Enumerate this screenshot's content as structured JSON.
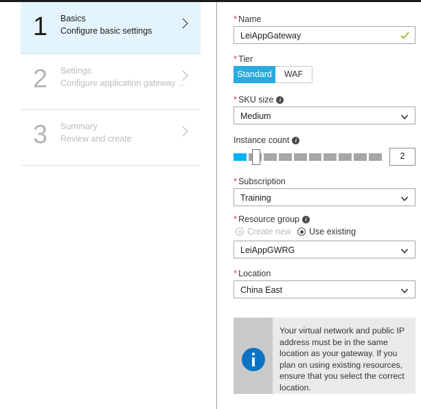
{
  "wizard": {
    "steps": [
      {
        "number": "1",
        "title": "Basics",
        "subtitle": "Configure basic settings",
        "chevron": "chevron-right-icon",
        "active": true
      },
      {
        "number": "2",
        "title": "Settings",
        "subtitle": "Configure application gateway ...",
        "chevron": "chevron-right-icon",
        "active": false
      },
      {
        "number": "3",
        "title": "Summary",
        "subtitle": "Review and create",
        "chevron": "chevron-right-icon",
        "active": false
      }
    ]
  },
  "form": {
    "name": {
      "label": "Name",
      "required": "*",
      "value": "LeiAppGateway",
      "validation_icon": "check-valid-icon"
    },
    "tier": {
      "label": "Tier",
      "required": "*",
      "options": [
        "Standard",
        "WAF"
      ],
      "selected": "Standard"
    },
    "sku_size": {
      "label": "SKU size",
      "required": "*",
      "info_icon": "info-icon",
      "value": "Medium",
      "chevron": "chevron-down-icon"
    },
    "instance_count": {
      "label": "Instance count",
      "info_icon": "info-icon",
      "value": "2",
      "segments": 10,
      "filled_segments": 1
    },
    "subscription": {
      "label": "Subscription",
      "required": "*",
      "value": "Training",
      "chevron": "chevron-down-icon"
    },
    "resource_group": {
      "label": "Resource group",
      "required": "*",
      "info_icon": "info-icon",
      "option_create": "Create new",
      "option_existing": "Use existing",
      "selected_option": "Use existing",
      "value": "LeiAppGWRG",
      "chevron": "chevron-down-icon"
    },
    "location": {
      "label": "Location",
      "required": "*",
      "value": "China East",
      "chevron": "chevron-down-icon"
    },
    "callout": {
      "icon": "info-circle-icon",
      "text": "Your virtual network and public IP address must be in the same location as your gateway. If you plan on using existing resources, ensure that you select the correct location."
    }
  },
  "colors": {
    "accent_blue": "#29aae1",
    "slider_fill": "#00b4f0",
    "active_step_bg": "#e3f4fc",
    "required_star": "#d6306d",
    "info_icon_blue": "#0a74c4"
  }
}
